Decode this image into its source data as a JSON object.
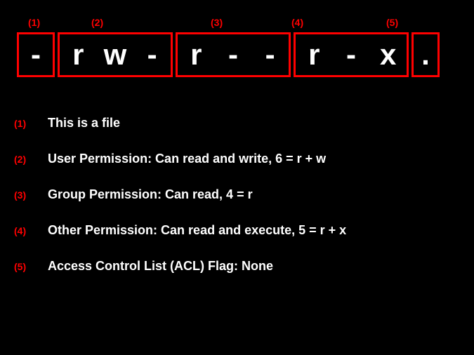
{
  "topLabels": {
    "l1": "(1)",
    "l2": "(2)",
    "l3": "(3)",
    "l4": "(4)",
    "l5": "(5)"
  },
  "boxes": {
    "b1": {
      "c1": "-"
    },
    "b2": {
      "c1": "r",
      "c2": "w",
      "c3": "-"
    },
    "b3": {
      "c1": "r",
      "c2": "-",
      "c3": "-"
    },
    "b4": {
      "c1": "r",
      "c2": "-",
      "c3": "x"
    },
    "b5": {
      "c1": "."
    }
  },
  "explanations": {
    "e1": {
      "num": "(1)",
      "text": "This is a file"
    },
    "e2": {
      "num": "(2)",
      "text": "User Permission: Can read and write, 6 = r + w"
    },
    "e3": {
      "num": "(3)",
      "text": "Group Permission: Can read, 4 = r"
    },
    "e4": {
      "num": "(4)",
      "text": "Other Permission: Can read and execute, 5 = r + x"
    },
    "e5": {
      "num": "(5)",
      "text": "Access Control List (ACL) Flag: None"
    }
  }
}
